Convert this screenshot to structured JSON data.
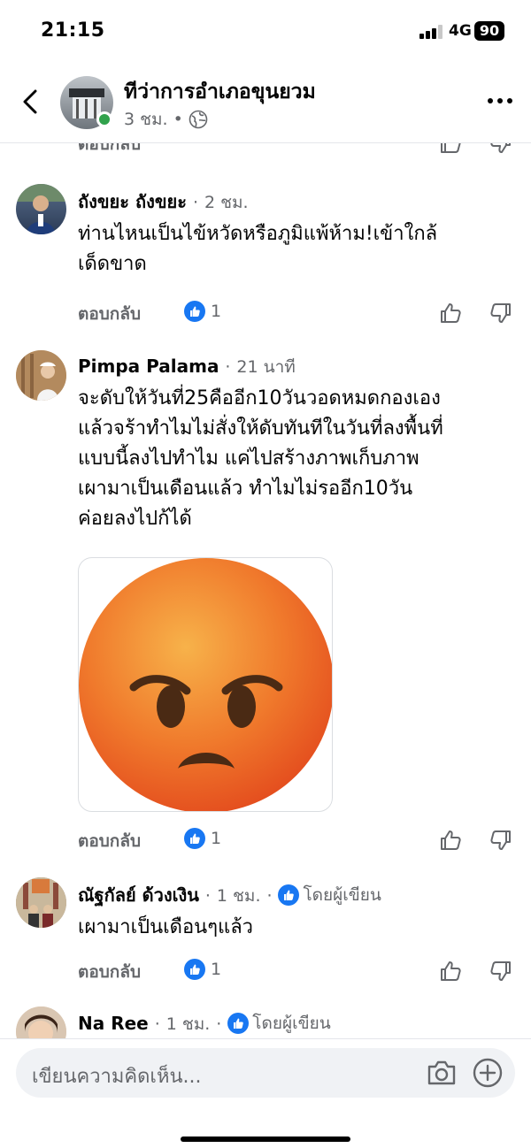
{
  "status_bar": {
    "time": "21:15",
    "network": "4G",
    "battery": "90"
  },
  "header": {
    "page_name": "ทีว่าการอำเภอขุนยวม",
    "time": "3 ชม.",
    "dot": "•"
  },
  "partial_top": {
    "reply_label": "ตอบกลับ"
  },
  "comments": [
    {
      "name": "ถังขยะ ถังขยะ",
      "sep": "·",
      "time": "2 ชม.",
      "text": "ท่านไหนเป็นไข้หวัดหรือภูมิแพ้ห้าม!เข้าใกล้\nเด็ดขาด",
      "reply_label": "ตอบกลับ",
      "like_count": "1"
    },
    {
      "name": "Pimpa Palama",
      "sep": "·",
      "time": "21 นาที",
      "text": "จะดับให้วันที่25คืออีก10วันวอดหมดกองเอง\nแล้วจร้าทำไมไม่สั่งให้ดับทันทีในวันที่ลงพื้นที่\nแบบนี้ลงไปทำไม แค่ไปสร้างภาพเก็บภาพ\nเผามาเป็นเดือนแล้ว  ทำไมไม่รออีก10วัน\nค่อยลงไปก้ได้",
      "attachment_icon": "angry-face-emoji",
      "reply_label": "ตอบกลับ",
      "like_count": "1"
    },
    {
      "name": "ณัฐกัลย์ ด้วงเงิน",
      "sep": "·",
      "time": "1 ชม.",
      "dot": "·",
      "author_label": "โดยผู้เขียน",
      "text": "เผามาเป็นเดือนๆแล้ว",
      "reply_label": "ตอบกลับ",
      "like_count": "1"
    },
    {
      "name": "Na Ree",
      "sep": "·",
      "time": "1 ชม.",
      "dot": "·",
      "author_label": "โดยผู้เขียน"
    }
  ],
  "composer": {
    "placeholder": "เขียนความคิดเห็น..."
  },
  "colors": {
    "accent": "#1877f2",
    "muted": "#65676b",
    "online": "#31a24c"
  }
}
